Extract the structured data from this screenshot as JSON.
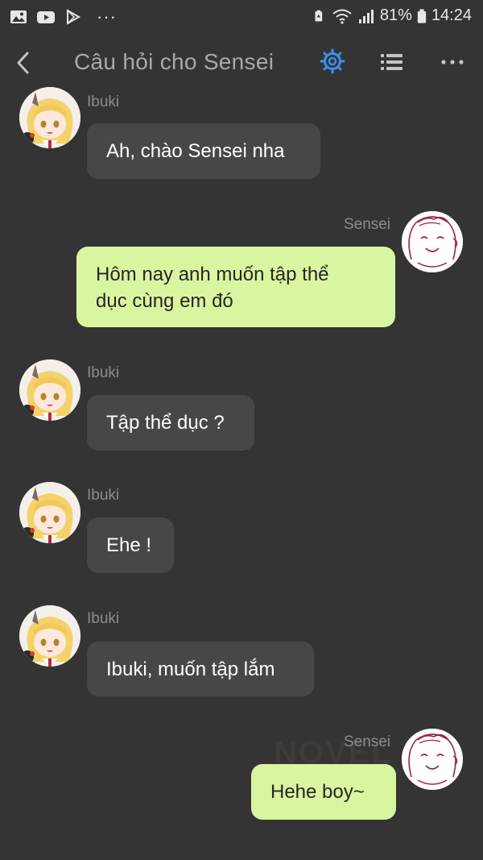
{
  "status_bar": {
    "battery_percent": "81%",
    "time": "14:24",
    "overflow": "···",
    "icons": [
      "gallery-icon",
      "youtube-icon",
      "play-store-icon",
      "battery-saver-icon",
      "wifi-icon",
      "signal-icon",
      "battery-icon"
    ]
  },
  "header": {
    "title": "Câu hỏi cho Sensei",
    "accent_color": "#3d8ff0",
    "icons": [
      "back-icon",
      "gear-icon",
      "list-icon",
      "more-icon"
    ]
  },
  "messages": [
    {
      "from": "Ibuki",
      "side": "left",
      "lines": [
        "Ah, chào Sensei nha"
      ]
    },
    {
      "from": "Sensei",
      "side": "right",
      "lines": [
        "Hôm nay anh muốn tập thể",
        "dục cùng em đó"
      ]
    },
    {
      "from": "Ibuki",
      "side": "left",
      "lines": [
        "Tập thể dục ?"
      ]
    },
    {
      "from": "Ibuki",
      "side": "left",
      "lines": [
        "Ehe !"
      ]
    },
    {
      "from": "Ibuki",
      "side": "left",
      "lines": [
        "Ibuki, muốn tập lắm"
      ]
    },
    {
      "from": "Sensei",
      "side": "right",
      "lines": [
        "Hehe boy~"
      ]
    }
  ],
  "watermark": "NOVEL",
  "colors": {
    "background": "#343434",
    "incoming_bubble": "#474747",
    "outgoing_bubble": "#d9f5a0",
    "sender_name": "#8c8c8c"
  }
}
